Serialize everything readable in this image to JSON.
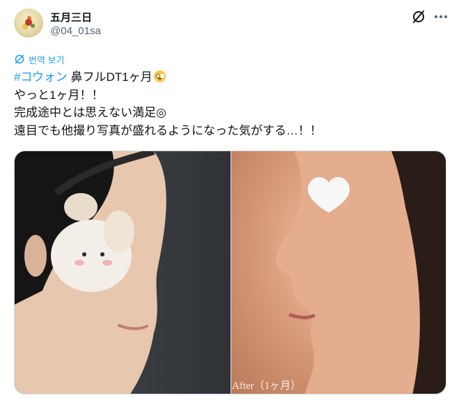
{
  "user": {
    "display_name": "五月三日",
    "handle": "@04_01sa"
  },
  "actions": {
    "grok_icon": "grok-icon",
    "more_icon": "more-icon"
  },
  "translate": {
    "label": "번역 보기"
  },
  "post": {
    "line1_hashtag": "#コウォン",
    "line1_rest": " 鼻フルDT1ヶ月",
    "line1_emoji": "flushed-face-emoji",
    "line2": "やっと1ヶ月！！",
    "line3": "完成途中とは思えない満足◎",
    "line4": "遠目でも他撮り写真が盛れるようになった気がする…！！"
  },
  "media": {
    "left_photo": "profile-before",
    "right_photo": "profile-after",
    "after_caption": "After（1ヶ月）"
  },
  "colors": {
    "link": "#1d9bf0",
    "text": "#0f1419",
    "secondary": "#536471"
  }
}
